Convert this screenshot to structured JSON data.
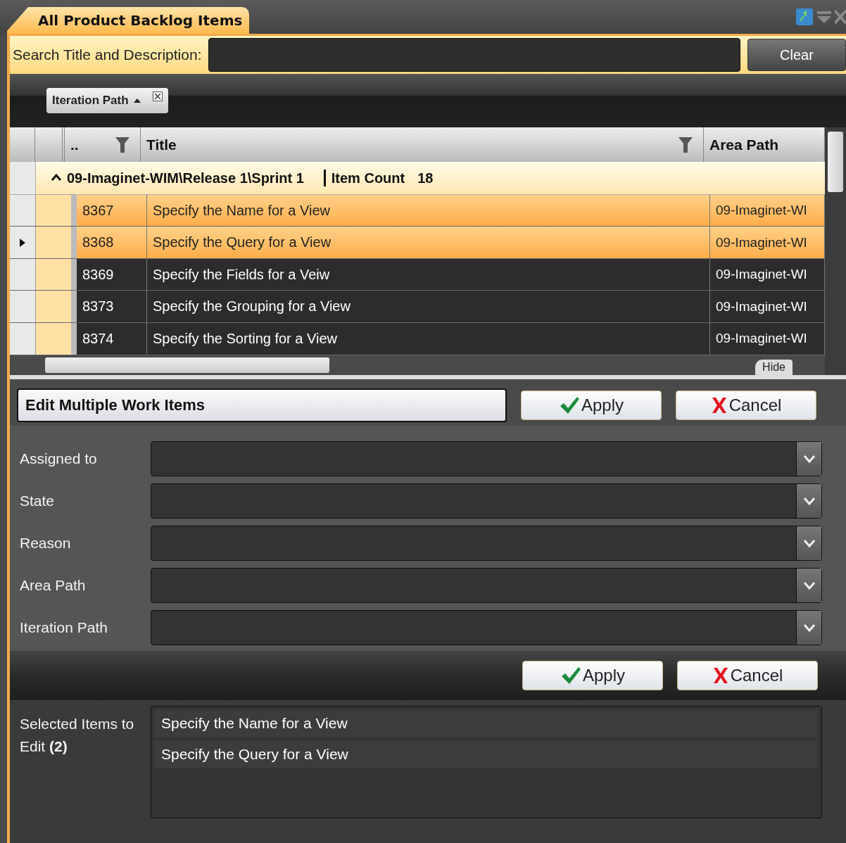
{
  "tab": {
    "title": "All Product Backlog Items",
    "selected": true
  },
  "search": {
    "label": "Search Title and Description:",
    "clear": "Clear"
  },
  "group_panel": {
    "chips": [
      {
        "label": "Iteration Path",
        "ascending": true
      }
    ]
  },
  "grid": {
    "columns": [
      "..",
      "Title",
      "Area Path"
    ],
    "group": {
      "label": "09-Imaginet-WIM\\Release 1\\Sprint 1",
      "count_label": "Item Count",
      "count": "18",
      "expanded": true
    },
    "rows": [
      {
        "id": "8367",
        "title": "Specify the Name for a View",
        "area_path": "09-Imaginet-WI",
        "selected": true,
        "current": false
      },
      {
        "id": "8368",
        "title": "Specify the Query for a View",
        "area_path": "09-Imaginet-WI",
        "selected": true,
        "current": true
      },
      {
        "id": "8369",
        "title": "Specify the Fields for a Veiw",
        "area_path": "09-Imaginet-WI",
        "selected": false,
        "current": false
      },
      {
        "id": "8373",
        "title": "Specify the Grouping for a View",
        "area_path": "09-Imaginet-WI",
        "selected": false,
        "current": false
      },
      {
        "id": "8374",
        "title": "Specify the Sorting for a View",
        "area_path": "09-Imaginet-WI",
        "selected": false,
        "current": false
      }
    ],
    "hide": "Hide"
  },
  "edit_panel": {
    "title": "Edit Multiple Work Items",
    "apply": "Apply",
    "cancel": "Cancel",
    "fields": [
      {
        "label": "Assigned to"
      },
      {
        "label": "State"
      },
      {
        "label": "Reason"
      },
      {
        "label": "Area Path"
      },
      {
        "label": "Iteration Path"
      }
    ],
    "apply_bottom": "Apply",
    "cancel_bottom": "Cancel",
    "selected_label": "Selected Items to Edit **(2)**",
    "selected_items": [
      "Specify the Name for a View",
      "Specify the Query for a View"
    ]
  }
}
